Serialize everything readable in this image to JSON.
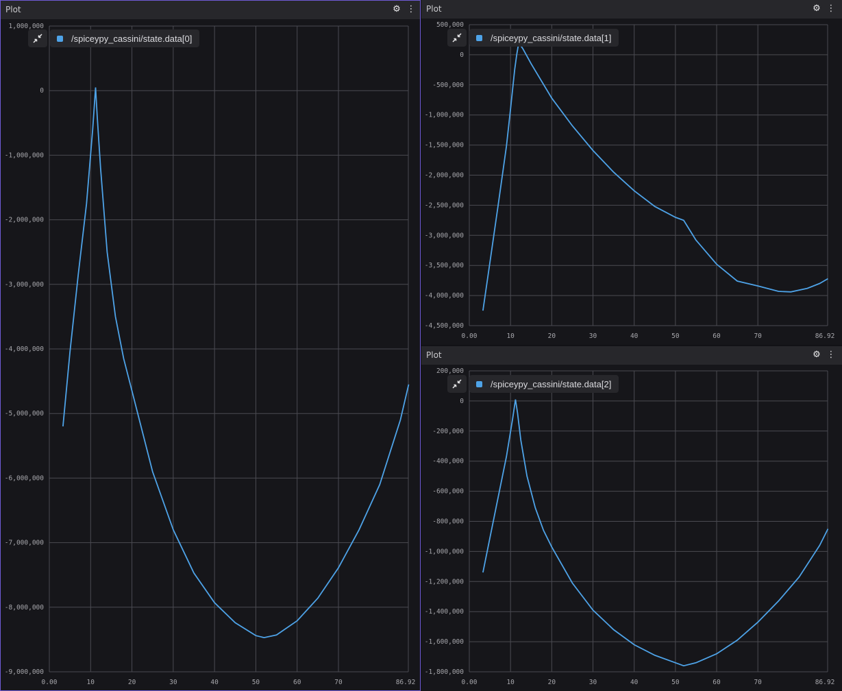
{
  "colors": {
    "series": "#4ea3e8",
    "accent": "#6f5bd6"
  },
  "icons": {
    "collapse": "collapse-arrows-icon",
    "settings": "gear-icon",
    "menu": "vertical-ellipsis-icon"
  },
  "panels": [
    {
      "title": "Plot",
      "legend": {
        "label": "/spiceypy_cassini/state.data[0]"
      },
      "chart_data": {
        "type": "line",
        "x": [
          3.3,
          5.0,
          7.0,
          9.0,
          10.5,
          11.2,
          11.6,
          12.4,
          14.0,
          16.0,
          18.0,
          20.0,
          25.0,
          30.0,
          35.0,
          40.0,
          45.0,
          50.0,
          52.0,
          55.0,
          60.0,
          65.0,
          70.0,
          75.0,
          80.0,
          85.0,
          87.0
        ],
        "series": [
          {
            "name": "/spiceypy_cassini/state.data[0]",
            "values": [
              -5200000,
              -4050000,
              -2850000,
              -1750000,
              -600000,
              50000,
              -400000,
              -1200000,
              -2500000,
              -3500000,
              -4150000,
              -4650000,
              -5900000,
              -6800000,
              -7470000,
              -7930000,
              -8240000,
              -8440000,
              -8470000,
              -8430000,
              -8210000,
              -7860000,
              -7390000,
              -6800000,
              -6100000,
              -5100000,
              -4550000
            ]
          }
        ],
        "xlim": [
          0,
          86.92
        ],
        "ylim": [
          -9000000,
          1000000
        ],
        "xticks": [
          "0.00",
          "10",
          "20",
          "30",
          "40",
          "50",
          "60",
          "70",
          "86.92"
        ],
        "yticks": [
          "1,000,000",
          "0",
          "-1,000,000",
          "-2,000,000",
          "-3,000,000",
          "-4,000,000",
          "-5,000,000",
          "-6,000,000",
          "-7,000,000",
          "-8,000,000",
          "-9,000,000"
        ],
        "grid": true,
        "legend_position": "top-left"
      }
    },
    {
      "title": "Plot",
      "legend": {
        "label": "/spiceypy_cassini/state.data[1]"
      },
      "chart_data": {
        "type": "line",
        "x": [
          3.3,
          5.0,
          7.0,
          9.0,
          10.0,
          11.0,
          11.5,
          12.0,
          13.0,
          15.0,
          20.0,
          25.0,
          30.0,
          35.0,
          40.0,
          45.0,
          50.0,
          52.0,
          55.0,
          60.0,
          65.0,
          70.0,
          75.0,
          78.0,
          82.0,
          85.0,
          87.0
        ],
        "series": [
          {
            "name": "/spiceypy_cassini/state.data[1]",
            "values": [
              -4250000,
              -3450000,
              -2500000,
              -1520000,
              -900000,
              -250000,
              0,
              200000,
              100000,
              -150000,
              -720000,
              -1180000,
              -1590000,
              -1950000,
              -2260000,
              -2520000,
              -2700000,
              -2750000,
              -3080000,
              -3480000,
              -3760000,
              -3840000,
              -3930000,
              -3940000,
              -3880000,
              -3800000,
              -3720000
            ]
          }
        ],
        "xlim": [
          0,
          86.92
        ],
        "ylim": [
          -4500000,
          500000
        ],
        "xticks": [
          "0.00",
          "10",
          "20",
          "30",
          "40",
          "50",
          "60",
          "70",
          "86.92"
        ],
        "yticks": [
          "500,000",
          "0",
          "-500,000",
          "-1,000,000",
          "-1,500,000",
          "-2,000,000",
          "-2,500,000",
          "-3,000,000",
          "-3,500,000",
          "-4,000,000",
          "-4,500,000"
        ],
        "grid": true,
        "legend_position": "top-left"
      }
    },
    {
      "title": "Plot",
      "legend": {
        "label": "/spiceypy_cassini/state.data[2]"
      },
      "chart_data": {
        "type": "line",
        "x": [
          3.3,
          5.0,
          7.0,
          9.0,
          10.5,
          11.2,
          11.7,
          12.5,
          14.0,
          16.0,
          18.0,
          20.0,
          25.0,
          30.0,
          35.0,
          40.0,
          45.0,
          50.0,
          52.0,
          55.0,
          60.0,
          65.0,
          70.0,
          75.0,
          80.0,
          85.0,
          87.0
        ],
        "series": [
          {
            "name": "/spiceypy_cassini/state.data[2]",
            "values": [
              -1140000,
              -910000,
              -640000,
              -370000,
              -120000,
              10000,
              -80000,
              -260000,
              -500000,
              -710000,
              -860000,
              -970000,
              -1210000,
              -1390000,
              -1520000,
              -1620000,
              -1690000,
              -1740000,
              -1760000,
              -1740000,
              -1680000,
              -1590000,
              -1470000,
              -1330000,
              -1170000,
              -960000,
              -850000
            ]
          }
        ],
        "xlim": [
          0,
          86.92
        ],
        "ylim": [
          -1800000,
          200000
        ],
        "xticks": [
          "0.00",
          "10",
          "20",
          "30",
          "40",
          "50",
          "60",
          "70",
          "86.92"
        ],
        "yticks": [
          "200,000",
          "0",
          "-200,000",
          "-400,000",
          "-600,000",
          "-800,000",
          "-1,000,000",
          "-1,200,000",
          "-1,400,000",
          "-1,600,000",
          "-1,800,000"
        ],
        "grid": true,
        "legend_position": "top-left"
      }
    }
  ]
}
